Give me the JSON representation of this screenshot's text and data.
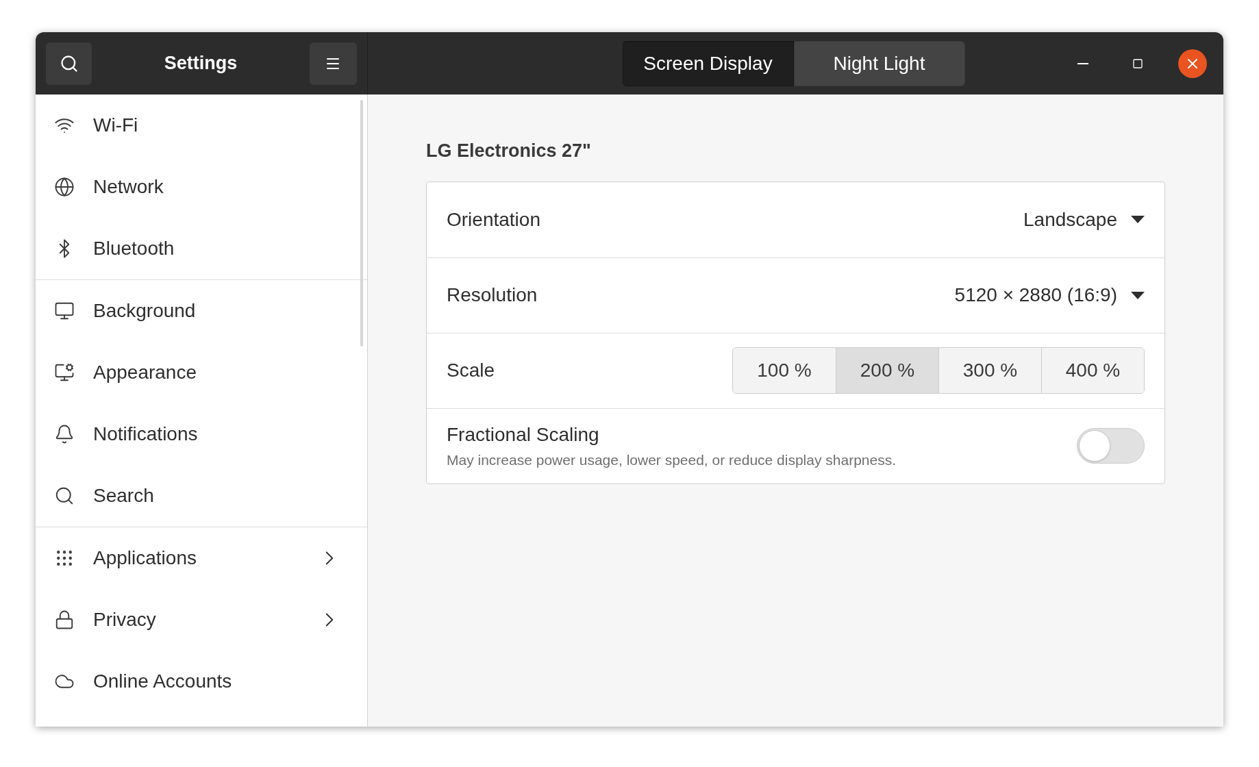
{
  "header": {
    "title": "Settings"
  },
  "tabs": [
    {
      "label": "Screen Display",
      "selected": true
    },
    {
      "label": "Night Light",
      "selected": false
    }
  ],
  "sidebar": {
    "groups": [
      [
        {
          "label": "Wi-Fi",
          "has_submenu": false
        },
        {
          "label": "Network",
          "has_submenu": false
        },
        {
          "label": "Bluetooth",
          "has_submenu": false
        }
      ],
      [
        {
          "label": "Background",
          "has_submenu": false
        },
        {
          "label": "Appearance",
          "has_submenu": false
        },
        {
          "label": "Notifications",
          "has_submenu": false
        },
        {
          "label": "Search",
          "has_submenu": false
        }
      ],
      [
        {
          "label": "Applications",
          "has_submenu": true
        },
        {
          "label": "Privacy",
          "has_submenu": true
        },
        {
          "label": "Online Accounts",
          "has_submenu": false
        }
      ]
    ]
  },
  "display": {
    "title": "LG Electronics 27\"",
    "rows": [
      {
        "kind": "dropdown",
        "label": "Orientation",
        "value": "Landscape"
      },
      {
        "kind": "dropdown",
        "label": "Resolution",
        "value": "5120 × 2880 (16:9)"
      },
      {
        "kind": "segmented",
        "label": "Scale",
        "options": [
          {
            "label": "100 %",
            "selected": false
          },
          {
            "label": "200 %",
            "selected": true
          },
          {
            "label": "300 %",
            "selected": false
          },
          {
            "label": "400 %",
            "selected": false
          }
        ]
      },
      {
        "kind": "switch",
        "label": "Fractional Scaling",
        "description": "May increase power usage, lower speed, or reduce display sharpness.",
        "on": false
      }
    ]
  }
}
